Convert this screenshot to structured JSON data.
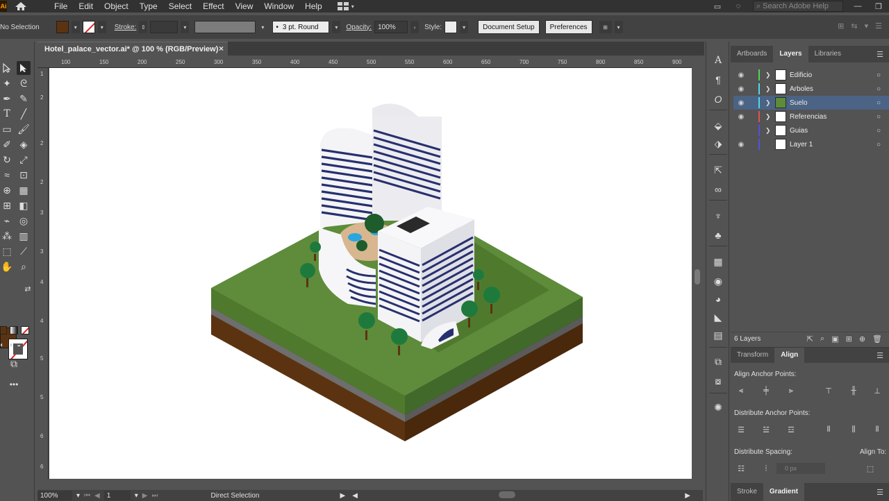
{
  "app": {
    "logo": "Ai",
    "menu": [
      "File",
      "Edit",
      "Object",
      "Type",
      "Select",
      "Effect",
      "View",
      "Window",
      "Help"
    ],
    "search_placeholder": "Search Adobe Help"
  },
  "control_bar": {
    "selection_label": "No Selection",
    "stroke_label": "Stroke:",
    "brush_value": "3 pt. Round",
    "opacity_label": "Opacity:",
    "opacity_value": "100%",
    "style_label": "Style:",
    "document_setup_label": "Document Setup",
    "preferences_label": "Preferences"
  },
  "document": {
    "tab_title": "Hotel_palace_vector.ai* @ 100 % (RGB/Preview)",
    "close_glyph": "×",
    "ruler_h": [
      "100",
      "150",
      "200",
      "250",
      "300",
      "350",
      "400",
      "450",
      "500",
      "550",
      "600",
      "650",
      "700",
      "750",
      "800",
      "850",
      "900"
    ],
    "ruler_v": [
      "1",
      "2",
      "2",
      "2",
      "3",
      "3",
      "4",
      "4",
      "5",
      "5",
      "6",
      "6"
    ]
  },
  "status": {
    "zoom": "100%",
    "artboard": "1",
    "tool": "Direct Selection"
  },
  "panels": {
    "top_tabs": [
      "Artboards",
      "Layers",
      "Libraries"
    ],
    "active_top_tab": "Layers",
    "layers": [
      {
        "name": "Edificio",
        "color": "#4ed74e",
        "visible": true,
        "expandable": true
      },
      {
        "name": "Arboles",
        "color": "#4fd8e8",
        "visible": true,
        "expandable": true
      },
      {
        "name": "Suelo",
        "color": "#4fd8e8",
        "visible": true,
        "expandable": true,
        "selected": true
      },
      {
        "name": "Referencias",
        "color": "#e25252",
        "visible": true,
        "expandable": true
      },
      {
        "name": "Guias",
        "color": "#5252e0",
        "visible": false,
        "expandable": true
      },
      {
        "name": "Layer 1",
        "color": "#5252e0",
        "visible": true,
        "expandable": false
      }
    ],
    "layers_count": "6 Layers",
    "lower_tabs": [
      "Transform",
      "Align"
    ],
    "active_lower_tab": "Align",
    "align_anchor_title": "Align Anchor Points:",
    "distribute_anchor_title": "Distribute Anchor Points:",
    "distribute_spacing_title": "Distribute Spacing:",
    "align_to_title": "Align To:",
    "spacing_value": "0 px",
    "bottom_tabs": [
      "Stroke",
      "Gradient"
    ],
    "active_bottom_tab": "Gradient"
  },
  "colors": {
    "fill": "#5c3311",
    "grass": "#5e8c3a",
    "soil": "#5c3311",
    "building_stripe": "#27306e"
  }
}
